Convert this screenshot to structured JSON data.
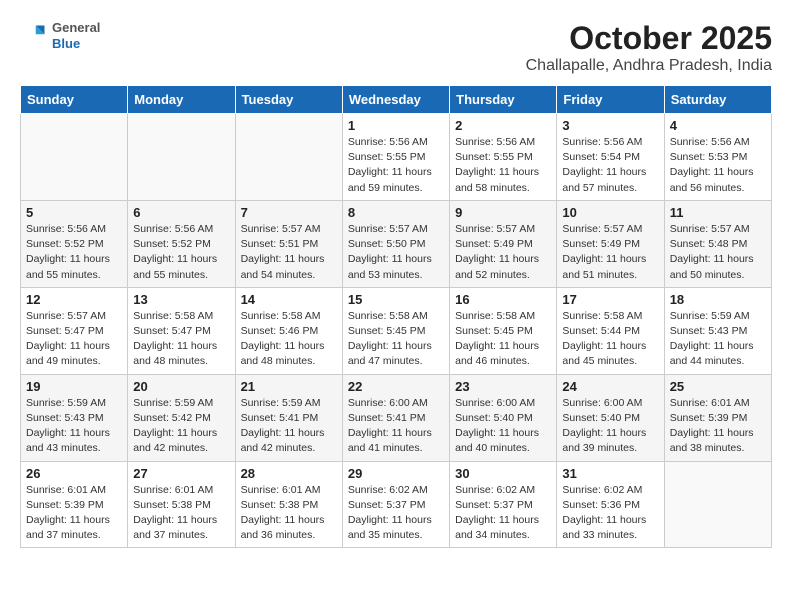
{
  "header": {
    "logo": {
      "general": "General",
      "blue": "Blue"
    },
    "title": "October 2025",
    "subtitle": "Challapalle, Andhra Pradesh, India"
  },
  "days_of_week": [
    "Sunday",
    "Monday",
    "Tuesday",
    "Wednesday",
    "Thursday",
    "Friday",
    "Saturday"
  ],
  "weeks": [
    [
      {
        "day": "",
        "info": ""
      },
      {
        "day": "",
        "info": ""
      },
      {
        "day": "",
        "info": ""
      },
      {
        "day": "1",
        "info": "Sunrise: 5:56 AM\nSunset: 5:55 PM\nDaylight: 11 hours\nand 59 minutes."
      },
      {
        "day": "2",
        "info": "Sunrise: 5:56 AM\nSunset: 5:55 PM\nDaylight: 11 hours\nand 58 minutes."
      },
      {
        "day": "3",
        "info": "Sunrise: 5:56 AM\nSunset: 5:54 PM\nDaylight: 11 hours\nand 57 minutes."
      },
      {
        "day": "4",
        "info": "Sunrise: 5:56 AM\nSunset: 5:53 PM\nDaylight: 11 hours\nand 56 minutes."
      }
    ],
    [
      {
        "day": "5",
        "info": "Sunrise: 5:56 AM\nSunset: 5:52 PM\nDaylight: 11 hours\nand 55 minutes."
      },
      {
        "day": "6",
        "info": "Sunrise: 5:56 AM\nSunset: 5:52 PM\nDaylight: 11 hours\nand 55 minutes."
      },
      {
        "day": "7",
        "info": "Sunrise: 5:57 AM\nSunset: 5:51 PM\nDaylight: 11 hours\nand 54 minutes."
      },
      {
        "day": "8",
        "info": "Sunrise: 5:57 AM\nSunset: 5:50 PM\nDaylight: 11 hours\nand 53 minutes."
      },
      {
        "day": "9",
        "info": "Sunrise: 5:57 AM\nSunset: 5:49 PM\nDaylight: 11 hours\nand 52 minutes."
      },
      {
        "day": "10",
        "info": "Sunrise: 5:57 AM\nSunset: 5:49 PM\nDaylight: 11 hours\nand 51 minutes."
      },
      {
        "day": "11",
        "info": "Sunrise: 5:57 AM\nSunset: 5:48 PM\nDaylight: 11 hours\nand 50 minutes."
      }
    ],
    [
      {
        "day": "12",
        "info": "Sunrise: 5:57 AM\nSunset: 5:47 PM\nDaylight: 11 hours\nand 49 minutes."
      },
      {
        "day": "13",
        "info": "Sunrise: 5:58 AM\nSunset: 5:47 PM\nDaylight: 11 hours\nand 48 minutes."
      },
      {
        "day": "14",
        "info": "Sunrise: 5:58 AM\nSunset: 5:46 PM\nDaylight: 11 hours\nand 48 minutes."
      },
      {
        "day": "15",
        "info": "Sunrise: 5:58 AM\nSunset: 5:45 PM\nDaylight: 11 hours\nand 47 minutes."
      },
      {
        "day": "16",
        "info": "Sunrise: 5:58 AM\nSunset: 5:45 PM\nDaylight: 11 hours\nand 46 minutes."
      },
      {
        "day": "17",
        "info": "Sunrise: 5:58 AM\nSunset: 5:44 PM\nDaylight: 11 hours\nand 45 minutes."
      },
      {
        "day": "18",
        "info": "Sunrise: 5:59 AM\nSunset: 5:43 PM\nDaylight: 11 hours\nand 44 minutes."
      }
    ],
    [
      {
        "day": "19",
        "info": "Sunrise: 5:59 AM\nSunset: 5:43 PM\nDaylight: 11 hours\nand 43 minutes."
      },
      {
        "day": "20",
        "info": "Sunrise: 5:59 AM\nSunset: 5:42 PM\nDaylight: 11 hours\nand 42 minutes."
      },
      {
        "day": "21",
        "info": "Sunrise: 5:59 AM\nSunset: 5:41 PM\nDaylight: 11 hours\nand 42 minutes."
      },
      {
        "day": "22",
        "info": "Sunrise: 6:00 AM\nSunset: 5:41 PM\nDaylight: 11 hours\nand 41 minutes."
      },
      {
        "day": "23",
        "info": "Sunrise: 6:00 AM\nSunset: 5:40 PM\nDaylight: 11 hours\nand 40 minutes."
      },
      {
        "day": "24",
        "info": "Sunrise: 6:00 AM\nSunset: 5:40 PM\nDaylight: 11 hours\nand 39 minutes."
      },
      {
        "day": "25",
        "info": "Sunrise: 6:01 AM\nSunset: 5:39 PM\nDaylight: 11 hours\nand 38 minutes."
      }
    ],
    [
      {
        "day": "26",
        "info": "Sunrise: 6:01 AM\nSunset: 5:39 PM\nDaylight: 11 hours\nand 37 minutes."
      },
      {
        "day": "27",
        "info": "Sunrise: 6:01 AM\nSunset: 5:38 PM\nDaylight: 11 hours\nand 37 minutes."
      },
      {
        "day": "28",
        "info": "Sunrise: 6:01 AM\nSunset: 5:38 PM\nDaylight: 11 hours\nand 36 minutes."
      },
      {
        "day": "29",
        "info": "Sunrise: 6:02 AM\nSunset: 5:37 PM\nDaylight: 11 hours\nand 35 minutes."
      },
      {
        "day": "30",
        "info": "Sunrise: 6:02 AM\nSunset: 5:37 PM\nDaylight: 11 hours\nand 34 minutes."
      },
      {
        "day": "31",
        "info": "Sunrise: 6:02 AM\nSunset: 5:36 PM\nDaylight: 11 hours\nand 33 minutes."
      },
      {
        "day": "",
        "info": ""
      }
    ]
  ]
}
